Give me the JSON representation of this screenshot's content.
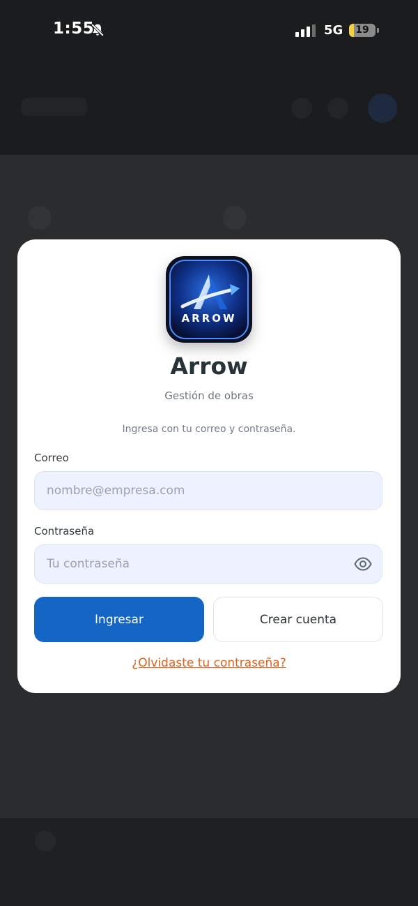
{
  "status_bar": {
    "time": "1:55",
    "network": "5G",
    "battery_level": "19",
    "battery_fraction": 0.19,
    "icons": [
      "bell-slash-icon",
      "signal-icon",
      "battery-icon"
    ]
  },
  "login": {
    "logo_text": "ARROW",
    "app_name": "Arrow",
    "subtitle": "Gestión de obras",
    "instructions": "Ingresa con tu correo y contraseña.",
    "email": {
      "label": "Correo",
      "placeholder": "nombre@empresa.com",
      "value": ""
    },
    "password": {
      "label": "Contraseña",
      "placeholder": "Tu contraseña",
      "value": "",
      "toggle_icon": "eye-icon"
    },
    "login_button": "Ingresar",
    "create_account_button": "Crear cuenta",
    "forgot_password_link": "¿Olvidaste tu contraseña?"
  },
  "colors": {
    "primary": "#1565c4",
    "link": "#e0621a",
    "input_bg": "#edf2fe",
    "overlay": "#2b2c2e",
    "battery_low": "#f3d23d"
  }
}
